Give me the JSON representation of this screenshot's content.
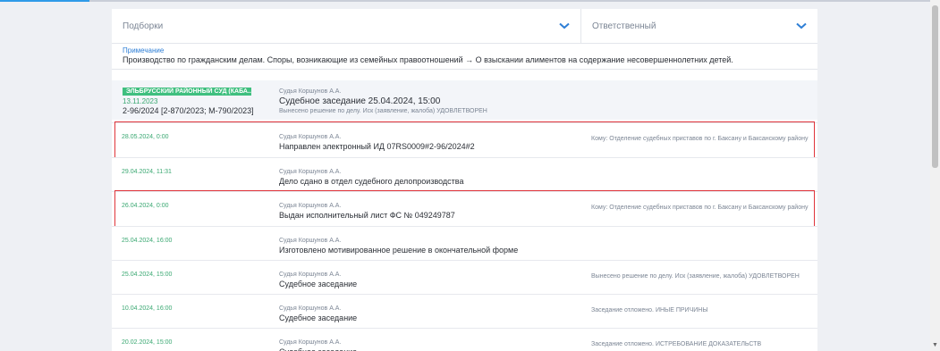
{
  "filters": {
    "collections": "Подборки",
    "responsible": "Ответственный"
  },
  "note": {
    "label": "Примечание",
    "text": "Производство по гражданским делам. Споры, возникающие из семейных правоотношений → О взыскании алиментов на содержание несовершеннолетних детей."
  },
  "case": {
    "court": "ЭЛЬБРУССКИЙ РАЙОННЫЙ СУД (КАБА...",
    "date": "13.11.2023",
    "number": "2-96/2024 [2-870/2023; М-790/2023]",
    "judge": "Судья Коршунов А.А.",
    "event": "Судебное заседание 25.04.2024, 15:00",
    "result": "Вынесено решение по делу. Иск (заявление, жалоба) УДОВЛЕТВОРЕН"
  },
  "events": [
    {
      "date": "28.05.2024, 0:00",
      "judge": "Судья Коршунов А.А.",
      "event": "Направлен электронный ИД 07RS0009#2-96/2024#2",
      "extra": "Кому: Отделение судебных приставов по г. Баксану и Баксанскому району",
      "highlighted": true
    },
    {
      "date": "29.04.2024, 11:31",
      "judge": "Судья Коршунов А.А.",
      "event": "Дело сдано в отдел судебного делопроизводства",
      "extra": "",
      "highlighted": false
    },
    {
      "date": "26.04.2024, 0:00",
      "judge": "Судья Коршунов А.А.",
      "event": "Выдан исполнительный лист ФС № 049249787",
      "extra": "Кому: Отделение судебных приставов по г. Баксану и Баксанскому району",
      "highlighted": true
    },
    {
      "date": "25.04.2024, 16:00",
      "judge": "Судья Коршунов А.А.",
      "event": "Изготовлено мотивированное решение в окончательной форме",
      "extra": "",
      "highlighted": false
    },
    {
      "date": "25.04.2024, 15:00",
      "judge": "Судья Коршунов А.А.",
      "event": "Судебное заседание",
      "extra": "Вынесено решение по делу. Иск (заявление, жалоба) УДОВЛЕТВОРЕН",
      "highlighted": false
    },
    {
      "date": "10.04.2024, 16:00",
      "judge": "Судья Коршунов А.А.",
      "event": "Судебное заседание",
      "extra": "Заседание отложено. ИНЫЕ ПРИЧИНЫ",
      "highlighted": false
    },
    {
      "date": "20.02.2024, 15:00",
      "judge": "Судья Коршунов А.А.",
      "event": "Судебное заседание",
      "extra": "Заседание отложено. ИСТРЕБОВАНИЕ ДОКАЗАТЕЛЬСТВ",
      "highlighted": false
    }
  ],
  "colors": {
    "accent": "#2f9be8",
    "date": "#3aa872",
    "badge": "#3fbf7f",
    "highlight": "#e0343a"
  }
}
